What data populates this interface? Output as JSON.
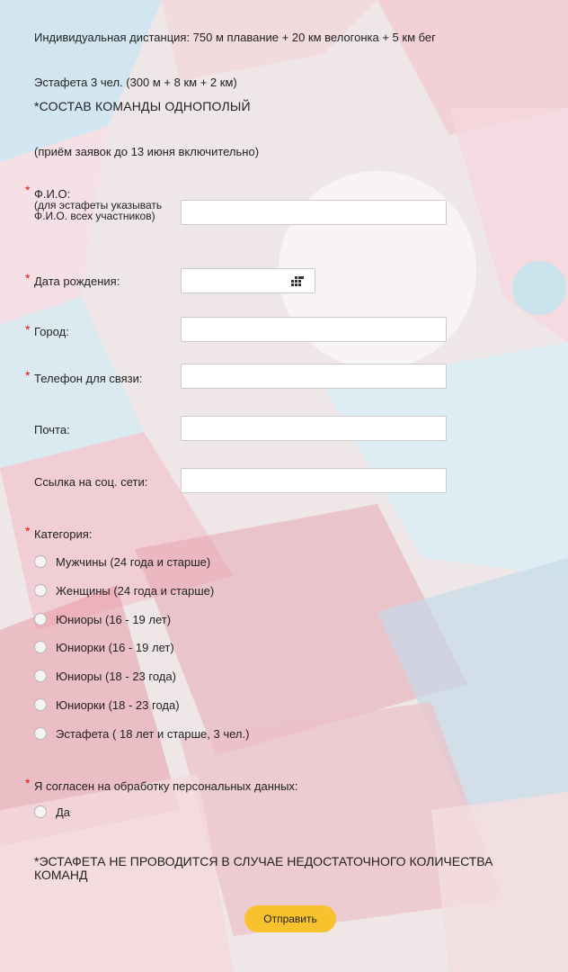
{
  "info": {
    "individual": "Индивидуальная дистанция: 750 м плавание + 20 км велогонка + 5 км бег",
    "relay": "Эстафета 3 чел. (300 м + 8 км + 2 км)",
    "team_note": "*СОСТАВ КОМАНДЫ ОДНОПОЛЫЙ",
    "deadline": "(приём заявок до 13 июня включительно)"
  },
  "form": {
    "required_mark": "*",
    "fio_label": "Ф.И.О:",
    "fio_sub": "(для эстафеты указывать Ф.И.О. всех участников)",
    "birth_label": "Дата рождения:",
    "city_label": "Город:",
    "phone_label": "Телефон для связи:",
    "email_label": "Почта:",
    "social_label": "Ссылка на соц. сети:",
    "category_label": "Категория:",
    "categories": [
      "Мужчины (24 года и старше)",
      "Женщины (24 года и старше)",
      "Юниоры (16 - 19 лет)",
      "Юниорки (16 - 19 лет)",
      "Юниоры (18 - 23 года)",
      "Юниорки (18 - 23 года)",
      "Эстафета ( 18 лет и старше, 3 чел.)"
    ],
    "consent_label": "Я согласен на обработку персональных данных:",
    "consent_option": "Да",
    "relay_note": "*ЭСТАФЕТА НЕ ПРОВОДИТСЯ В СЛУЧАЕ НЕДОСТАТОЧНОГО КОЛИЧЕСТВА КОМАНД",
    "submit": "Отправить"
  },
  "colors": {
    "required": "#dd1111",
    "button": "#f7c22d"
  },
  "icons": {
    "date_picker": "calendar-grid-icon"
  }
}
